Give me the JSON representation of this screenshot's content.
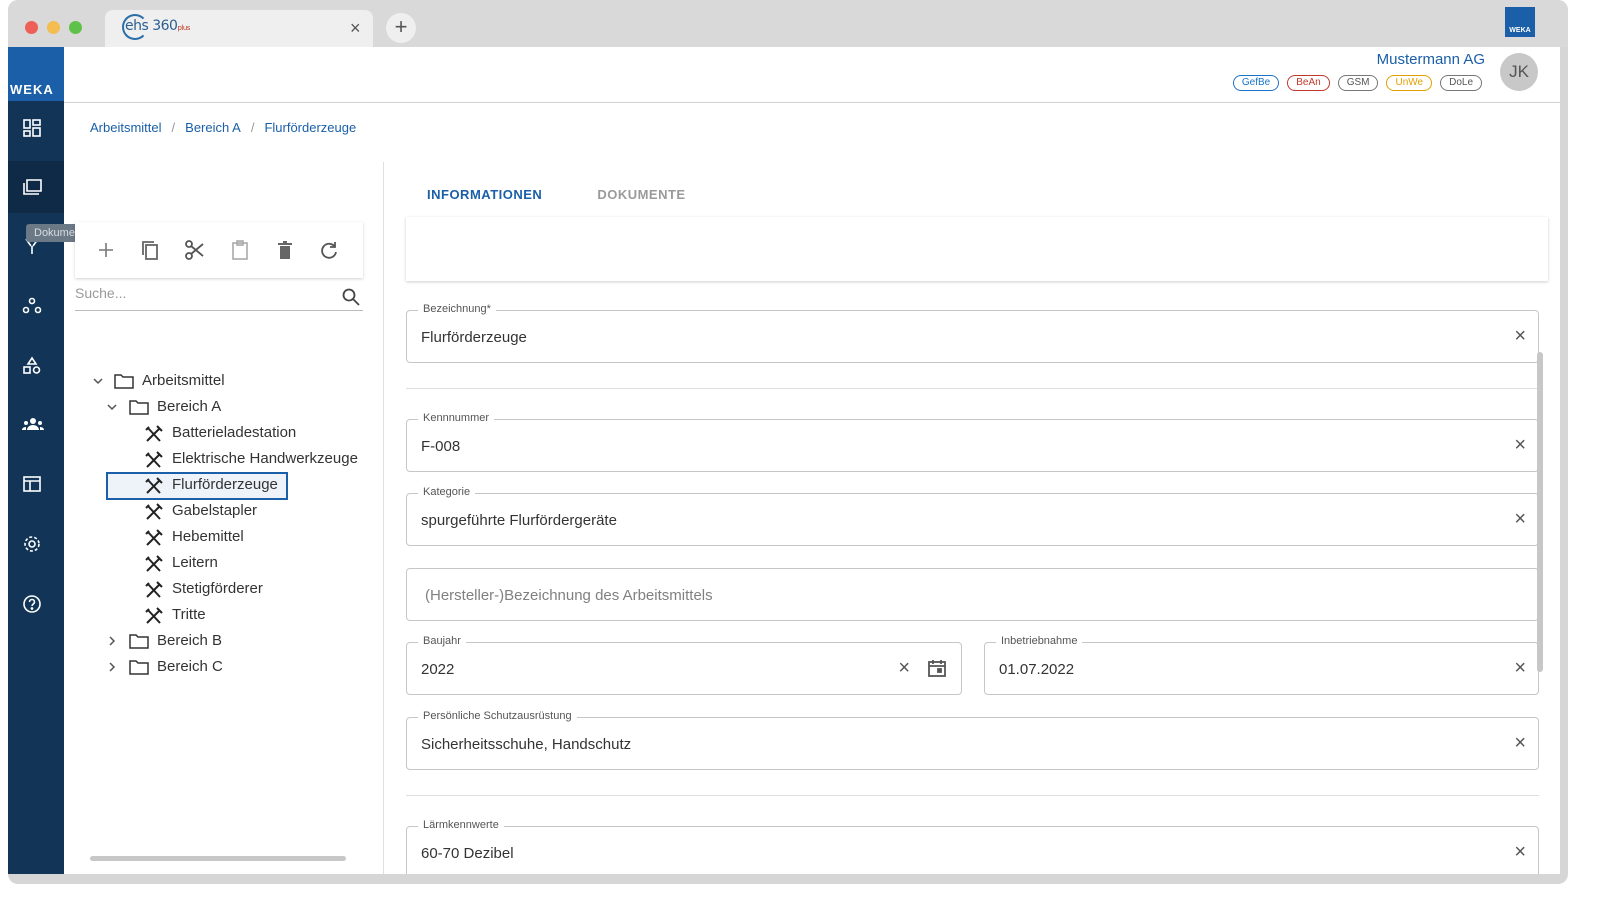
{
  "browser": {
    "tab_title": "ehs 360",
    "tab_title_suffix": "plus",
    "close_glyph": "×",
    "new_tab_glyph": "+",
    "brand_mini": "WEKA"
  },
  "sidebar": {
    "logo": "WEKA",
    "tooltip": "Dokumente",
    "items": [
      {
        "icon": "dashboard-icon"
      },
      {
        "icon": "folder-icon"
      },
      {
        "icon": "branch-icon"
      },
      {
        "icon": "hierarchy-icon"
      },
      {
        "icon": "shapes-icon"
      },
      {
        "icon": "people-icon"
      },
      {
        "icon": "table-icon"
      },
      {
        "icon": "gear-icon"
      },
      {
        "icon": "help-icon"
      }
    ]
  },
  "header": {
    "company": "Mustermann AG",
    "avatar_initials": "JK",
    "badges": [
      {
        "label": "GefBe",
        "color": "#1a73c8"
      },
      {
        "label": "BeAn",
        "color": "#c0392b"
      },
      {
        "label": "GSM",
        "color": "#555555"
      },
      {
        "label": "UnWe",
        "color": "#e0a000"
      },
      {
        "label": "DoLe",
        "color": "#555555"
      }
    ]
  },
  "breadcrumb": [
    "Arbeitsmittel",
    "Bereich A",
    "Flurförderzeuge"
  ],
  "breadcrumb_sep": "/",
  "tree": {
    "search_placeholder": "Suche...",
    "toolbar": [
      "add",
      "copy",
      "cut",
      "paste",
      "delete",
      "refresh"
    ],
    "nodes": [
      {
        "label": "Arbeitsmittel",
        "type": "folder",
        "expanded": true,
        "level": 0
      },
      {
        "label": "Bereich A",
        "type": "folder",
        "expanded": true,
        "level": 1
      },
      {
        "label": "Batterieladestation",
        "type": "tool",
        "level": 2
      },
      {
        "label": "Elektrische Handwerkzeuge",
        "type": "tool",
        "level": 2
      },
      {
        "label": "Flurförderzeuge",
        "type": "tool",
        "level": 2,
        "selected": true
      },
      {
        "label": "Gabelstapler",
        "type": "tool",
        "level": 2
      },
      {
        "label": "Hebemittel",
        "type": "tool",
        "level": 2
      },
      {
        "label": "Leitern",
        "type": "tool",
        "level": 2
      },
      {
        "label": "Stetigförderer",
        "type": "tool",
        "level": 2
      },
      {
        "label": "Tritte",
        "type": "tool",
        "level": 2
      },
      {
        "label": "Bereich B",
        "type": "folder",
        "expanded": false,
        "level": 1
      },
      {
        "label": "Bereich C",
        "type": "folder",
        "expanded": false,
        "level": 1
      }
    ]
  },
  "tabs": [
    {
      "label": "INFORMATIONEN",
      "active": true
    },
    {
      "label": "DOKUMENTE",
      "active": false
    }
  ],
  "form": {
    "bezeichnung": {
      "label": "Bezeichnung*",
      "value": "Flurförderzeuge"
    },
    "kennnummer": {
      "label": "Kennnummer",
      "value": "F-008"
    },
    "kategorie": {
      "label": "Kategorie",
      "value": "spurgeführte Flurfördergeräte"
    },
    "hersteller": {
      "placeholder": "(Hersteller-)Bezeichnung des Arbeitsmittels"
    },
    "baujahr": {
      "label": "Baujahr",
      "value": "2022"
    },
    "inbetriebnahme": {
      "label": "Inbetriebnahme",
      "value": "01.07.2022"
    },
    "psa": {
      "label": "Persönliche Schutzausrüstung",
      "value": "Sicherheitsschuhe, Handschutz"
    },
    "laerm": {
      "label": "Lärmkennwerte",
      "value": "60-70 Dezibel"
    },
    "clear_glyph": "×"
  }
}
